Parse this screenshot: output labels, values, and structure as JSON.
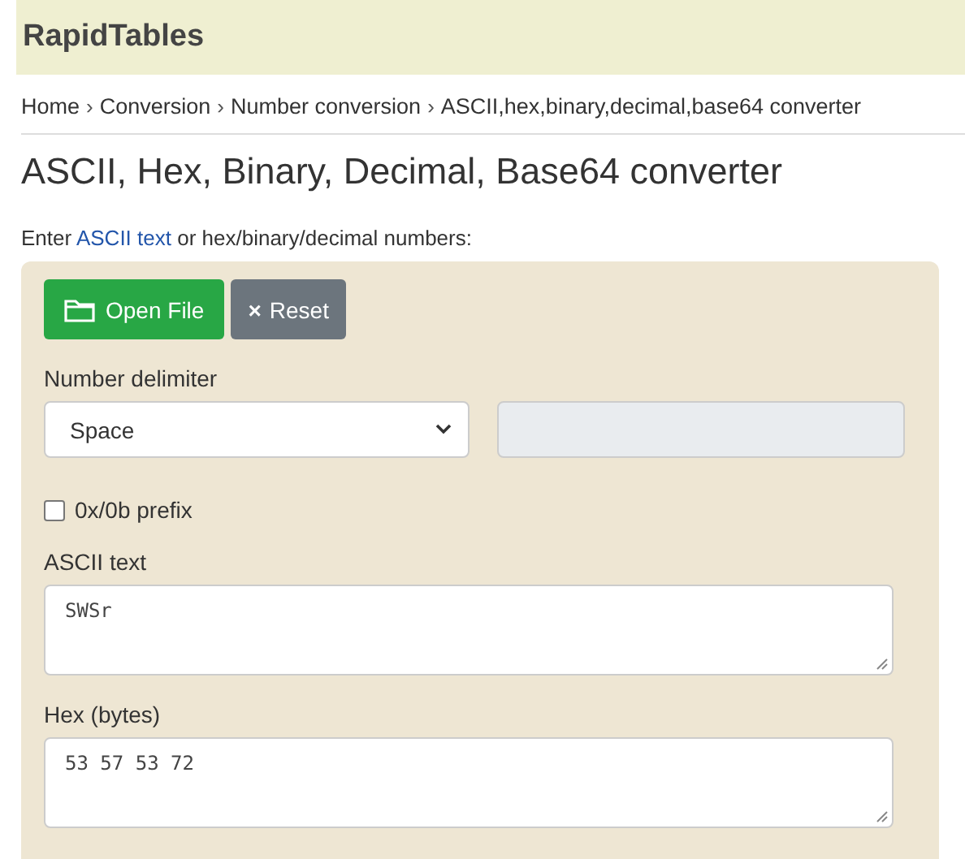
{
  "header": {
    "logo": "RapidTables"
  },
  "breadcrumb": [
    {
      "kind": "link",
      "text": "Home"
    },
    {
      "kind": "separator",
      "text": "›"
    },
    {
      "kind": "link",
      "text": "Conversion"
    },
    {
      "kind": "separator",
      "text": "›"
    },
    {
      "kind": "link",
      "text": "Number conversion"
    },
    {
      "kind": "separator",
      "text": "›"
    },
    {
      "kind": "link",
      "text": "ASCII,hex,binary,decimal,base64 converter"
    }
  ],
  "title": "ASCII, Hex, Binary, Decimal, Base64 converter",
  "intro": {
    "before": "Enter ",
    "link": "ASCII text",
    "after": " or hex/binary/decimal numbers:"
  },
  "buttons": [
    {
      "kind": "open",
      "label": "Open File"
    },
    {
      "kind": "reset",
      "icon": "×",
      "label": "Reset"
    }
  ],
  "delimiter": {
    "label": "Number delimiter",
    "value": "Space",
    "custom_disabled": true
  },
  "prefix": {
    "label": "0x/0b prefix",
    "checked": false
  },
  "fields": [
    {
      "label": "ASCII text",
      "value": "SWSr"
    },
    {
      "label": "Hex (bytes)",
      "value": "53 57 53 72"
    }
  ]
}
